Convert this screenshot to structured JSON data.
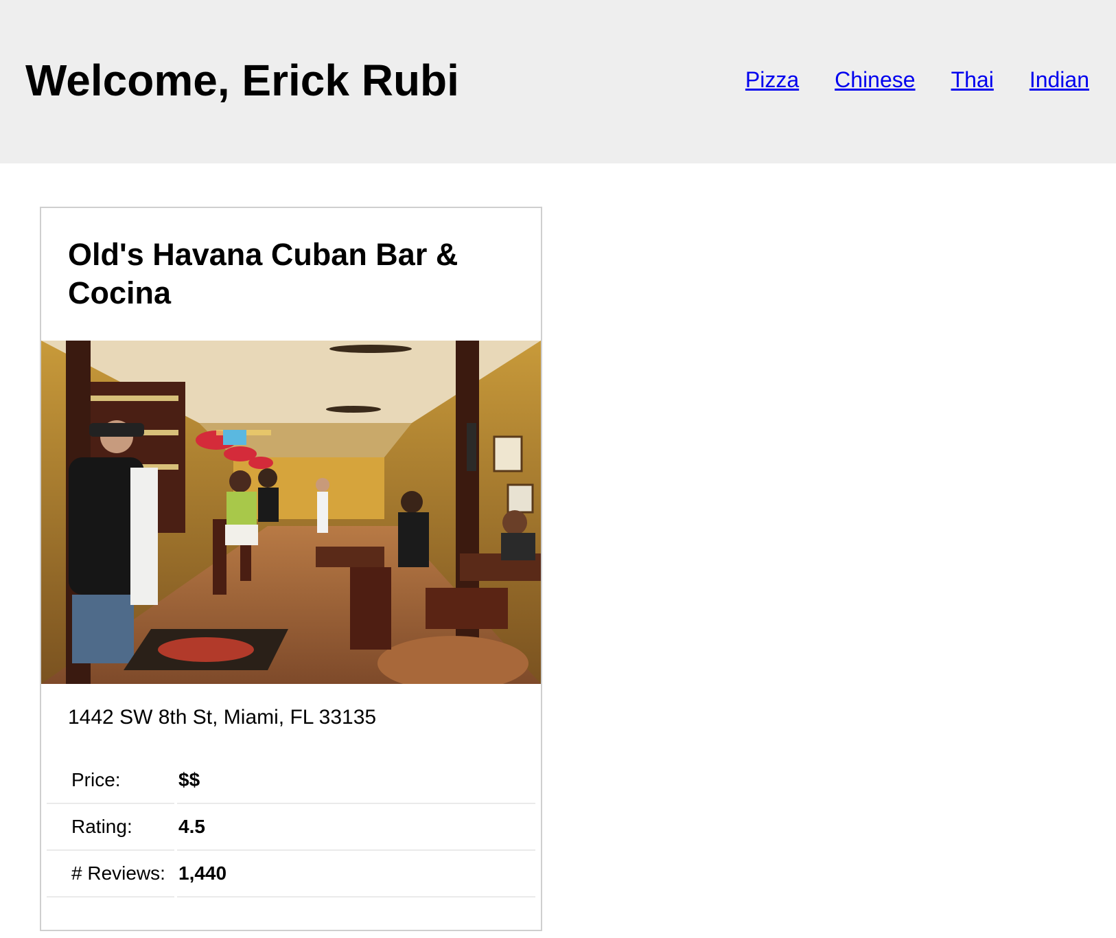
{
  "header": {
    "welcome": "Welcome, Erick Rubi",
    "nav": [
      {
        "label": "Pizza"
      },
      {
        "label": "Chinese"
      },
      {
        "label": "Thai"
      },
      {
        "label": "Indian"
      }
    ]
  },
  "restaurant": {
    "name": "Old's Havana Cuban Bar & Cocina",
    "photo_icon": "restaurant-interior-photo",
    "address": "1442 SW 8th St, Miami, FL 33135",
    "details": [
      {
        "label": "Price:",
        "value": "$$"
      },
      {
        "label": "Rating:",
        "value": "4.5"
      },
      {
        "label": "# Reviews:",
        "value": "1,440"
      }
    ]
  },
  "colors": {
    "header_bg": "#eeeeee",
    "link": "#0000ee",
    "card_border": "#cfcfcf"
  }
}
